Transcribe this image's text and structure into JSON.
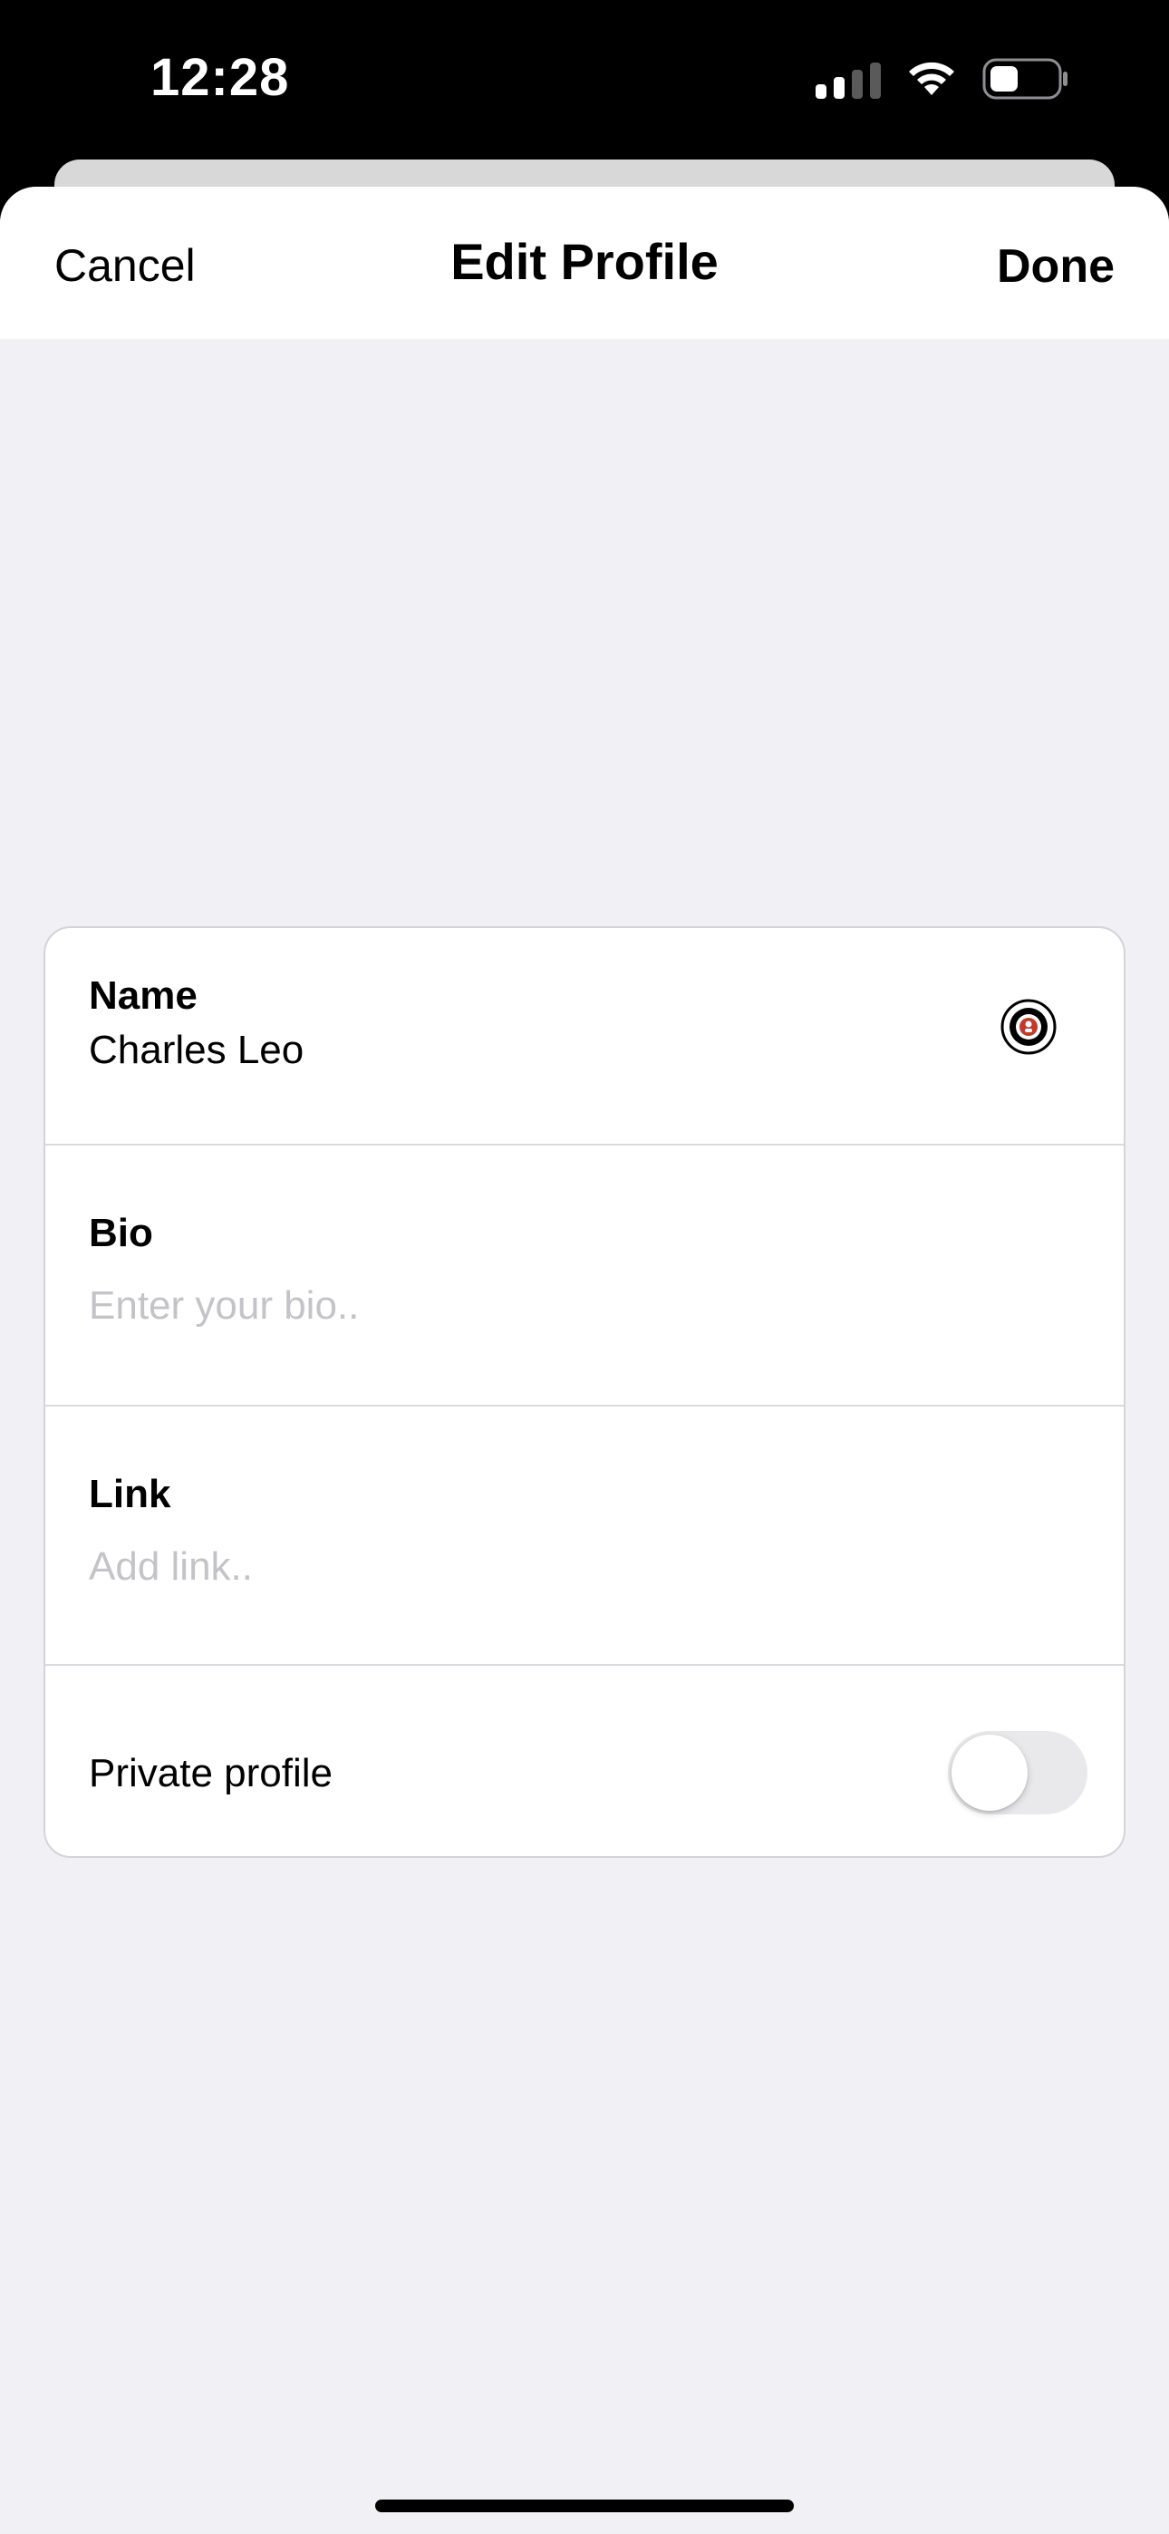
{
  "status_bar": {
    "time": "12:28",
    "icons": [
      "cellular-signal-icon",
      "wifi-icon",
      "battery-icon"
    ]
  },
  "nav": {
    "cancel_label": "Cancel",
    "title": "Edit Profile",
    "done_label": "Done"
  },
  "form": {
    "name": {
      "label": "Name",
      "value": "Charles Leo",
      "icon": "avatar-icon"
    },
    "bio": {
      "label": "Bio",
      "placeholder": "Enter your bio.."
    },
    "link": {
      "label": "Link",
      "placeholder": "Add link.."
    },
    "private_profile": {
      "label": "Private profile",
      "enabled": false
    }
  },
  "colors": {
    "sheet_background": "#f0f0f5",
    "card_background": "#ffffff",
    "placeholder_text": "#c4c4c8",
    "toggle_off_track": "#e9e9eb"
  }
}
